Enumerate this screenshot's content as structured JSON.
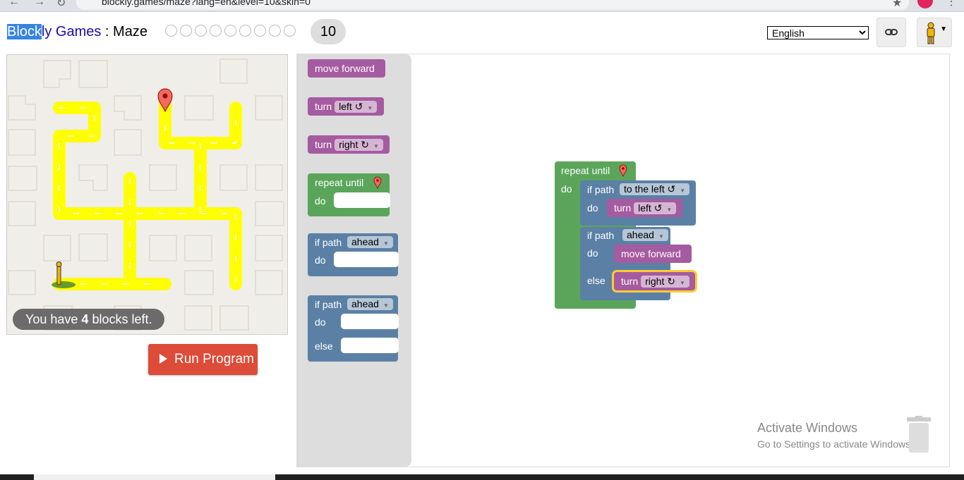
{
  "browser": {
    "url": "blockly.games/maze?lang=en&level=10&skin=0"
  },
  "header": {
    "title_selected": "Block",
    "title_rest": "ly Games",
    "separator": " : ",
    "game": "Maze",
    "current_level": "10",
    "language": "English",
    "language_options": [
      "English"
    ]
  },
  "maze": {
    "blocks_left_prefix": "You have ",
    "blocks_left_count": "4",
    "blocks_left_suffix": " blocks left.",
    "run_label": "Run Program"
  },
  "toolbox": {
    "move_forward": "move forward",
    "turn_label": "turn",
    "left_option": "left ↺",
    "right_option": "right ↻",
    "repeat_until": "repeat until",
    "do_label": "do",
    "if_path": "if path",
    "ahead_option": "ahead",
    "else_label": "else"
  },
  "program": {
    "repeat_until": "repeat until",
    "do": "do",
    "if1_label": "if path",
    "if1_option": "to the left ↺",
    "if1_do": "do",
    "turn1_label": "turn",
    "turn1_option": "left ↺",
    "if2_label": "if path",
    "if2_option": "ahead",
    "if2_do": "do",
    "move_forward": "move forward",
    "else": "else",
    "turn2_label": "turn",
    "turn2_option": "right ↻"
  },
  "watermark": {
    "title": "Activate Windows",
    "subtitle": "Go to Settings to activate Windows."
  },
  "colors": {
    "motion": "#a55b9f",
    "loops": "#5ba55b",
    "logic": "#5b80a5",
    "run_button": "#dd4b39",
    "path": "#ffff00"
  }
}
